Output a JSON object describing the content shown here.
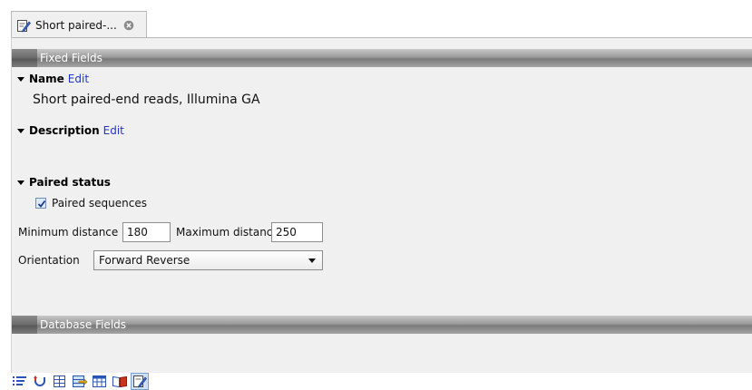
{
  "tab": {
    "label": "Short paired-...",
    "icon": "sequence-list-edit-icon",
    "close_icon": "close-circle-icon"
  },
  "sections": {
    "fixed_fields": "Fixed Fields",
    "database_fields": "Database Fields"
  },
  "name": {
    "heading": "Name",
    "edit": "Edit",
    "value": "Short paired-end reads, Illumina GA"
  },
  "description": {
    "heading": "Description",
    "edit": "Edit"
  },
  "paired_status": {
    "heading": "Paired status",
    "checkbox_label": "Paired sequences",
    "checked": true,
    "min_label": "Minimum distance",
    "min_value": "180",
    "max_label": "Maximum distance",
    "max_value": "250",
    "orientation_label": "Orientation",
    "orientation_value": "Forward Reverse"
  },
  "toolbar": {
    "icons": [
      "bullet-list-icon",
      "sort-icon",
      "table-grid-icon",
      "export-icon",
      "spreadsheet-icon",
      "book-icon",
      "edit-element-icon"
    ]
  },
  "colors": {
    "accent_link": "#2035c8",
    "panel_bg": "#f0f0f0",
    "section_bar": "#8c8c8c"
  }
}
